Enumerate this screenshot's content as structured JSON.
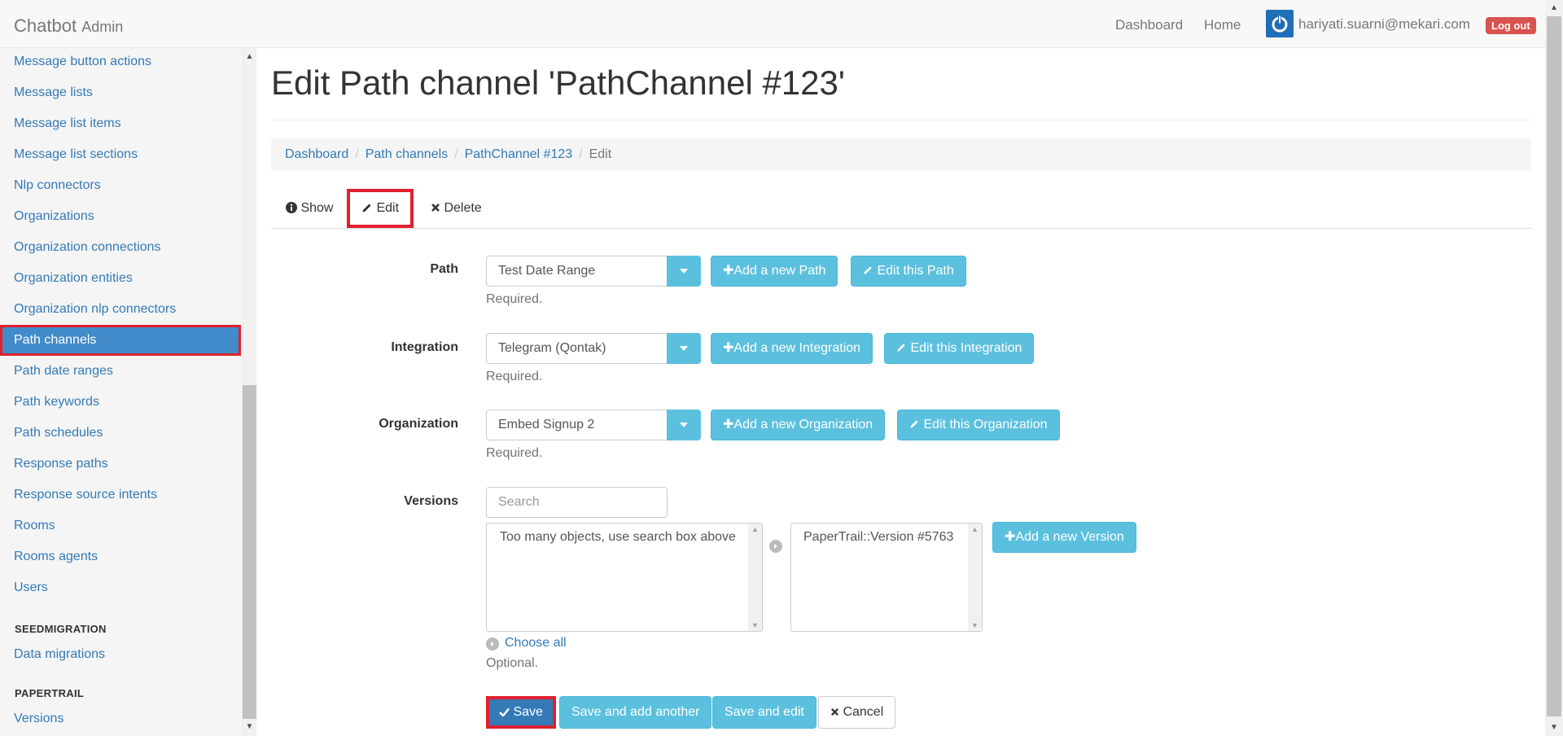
{
  "navbar": {
    "brand": "Chatbot",
    "brand_sub": "Admin",
    "links": [
      "Dashboard",
      "Home"
    ],
    "user_email": "hariyati.suarni@mekari.com",
    "logout": "Log out"
  },
  "sidebar": {
    "items": [
      "Message button actions",
      "Message lists",
      "Message list items",
      "Message list sections",
      "Nlp connectors",
      "Organizations",
      "Organization connections",
      "Organization entities",
      "Organization nlp connectors",
      "Path channels",
      "Path date ranges",
      "Path keywords",
      "Path schedules",
      "Response paths",
      "Response source intents",
      "Rooms",
      "Rooms agents",
      "Users"
    ],
    "active_item": "Path channels",
    "section_seed": "SEEDMIGRATION",
    "seed_item": "Data migrations",
    "section_paper": "PAPERTRAIL",
    "paper_item": "Versions"
  },
  "page": {
    "title": "Edit Path channel 'PathChannel #123'",
    "breadcrumb": [
      "Dashboard",
      "Path channels",
      "PathChannel #123",
      "Edit"
    ],
    "tabs": [
      "Show",
      "Edit",
      "Delete"
    ]
  },
  "form": {
    "path": {
      "label": "Path",
      "value": "Test Date Range",
      "add": "Add a new Path",
      "edit": "Edit this Path",
      "help": "Required."
    },
    "integration": {
      "label": "Integration",
      "value": "Telegram (Qontak)",
      "add": "Add a new Integration",
      "edit": "Edit this Integration",
      "help": "Required."
    },
    "organization": {
      "label": "Organization",
      "value": "Embed Signup 2",
      "add": "Add a new Organization",
      "edit": "Edit this Organization",
      "help": "Required."
    },
    "versions": {
      "label": "Versions",
      "search_placeholder": "Search",
      "available_text": "Too many objects, use search box above",
      "selected_text": "PaperTrail::Version #5763",
      "add": "Add a new Version",
      "choose_all": "Choose all",
      "help": "Optional."
    }
  },
  "actions": {
    "save": "Save",
    "save_add": "Save and add another",
    "save_edit": "Save and edit",
    "cancel": "Cancel"
  },
  "colors": {
    "primary": "#337ab7",
    "info": "#5bc0de",
    "danger": "#d9534f",
    "highlight": "#e0202e"
  }
}
